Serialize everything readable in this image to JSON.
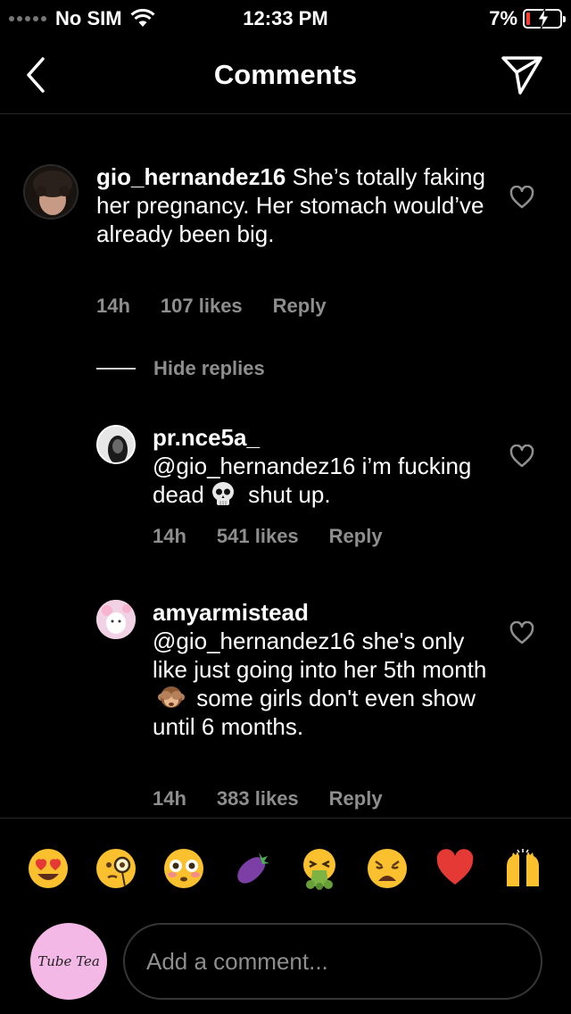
{
  "status_bar": {
    "carrier": "No SIM",
    "time": "12:33 PM",
    "battery_percent": "7%"
  },
  "nav": {
    "title": "Comments"
  },
  "comments": [
    {
      "username": "gio_hernandez16",
      "text": " She’s totally faking her pregnancy. Her stomach would’ve already been big.",
      "time": "14h",
      "likes": "107 likes",
      "reply_label": "Reply"
    }
  ],
  "hide_replies_label": "Hide replies",
  "replies": [
    {
      "username": "pr.nce5a_",
      "text_before": "@gio_hernandez16 i’m fucking dead",
      "emoji": "skull-emoji",
      "text_after": " shut up.",
      "time": "14h",
      "likes": "541 likes",
      "reply_label": "Reply"
    },
    {
      "username": "amyarmistead",
      "text_before": "@gio_hernandez16 she's only like just going into her 5th month",
      "emoji": "see-no-evil-monkey-emoji",
      "text_after": " some girls don't even show until 6 months.",
      "time": "14h",
      "likes": "383 likes",
      "reply_label": "Reply"
    }
  ],
  "emoji_bar": [
    "heart-eyes-emoji",
    "monocle-emoji",
    "flushed-emoji",
    "eggplant-emoji",
    "vomit-emoji",
    "weary-emoji",
    "red-heart-emoji",
    "raised-hands-emoji"
  ],
  "composer": {
    "avatar_text": "Tube Tea",
    "placeholder": "Add a comment..."
  },
  "colors": {
    "background": "#000000",
    "secondary_text": "#8e8e8e",
    "divider": "#262626",
    "battery_low": "#ff3b30"
  }
}
